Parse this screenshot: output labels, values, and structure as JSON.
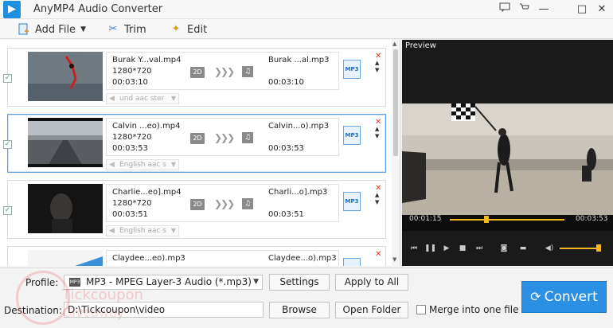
{
  "window": {
    "title": "AnyMP4 Audio Converter",
    "feedback_icon": "chat-icon",
    "cart_icon": "cart-icon",
    "minimize": "—",
    "maximize": "□",
    "close": "✕"
  },
  "toolbar": {
    "add_file_label": "Add File",
    "trim_label": "Trim",
    "edit_label": "Edit"
  },
  "files": [
    {
      "source_name": "Burak Y...val.mp4",
      "resolution": "1280*720",
      "duration": "00:03:10",
      "mode": "2D",
      "output_name": "Burak ...al.mp3",
      "output_duration": "00:03:10",
      "audio_track": "und aac ster",
      "output_format": "MP3"
    },
    {
      "source_name": "Calvin ...eo).mp4",
      "resolution": "1280*720",
      "duration": "00:03:53",
      "mode": "2D",
      "output_name": "Calvin...o).mp3",
      "output_duration": "00:03:53",
      "audio_track": "English aac s",
      "output_format": "MP3"
    },
    {
      "source_name": "Charlie...eo].mp4",
      "resolution": "1280*720",
      "duration": "00:03:51",
      "mode": "2D",
      "output_name": "Charli...o].mp3",
      "output_duration": "00:03:51",
      "audio_track": "English aac s",
      "output_format": "MP3"
    },
    {
      "source_name": "Claydee...eo).mp3",
      "resolution": "",
      "duration": "",
      "mode": "",
      "output_name": "Claydee...o).mp3",
      "output_duration": "",
      "audio_track": "",
      "output_format": "MP3"
    }
  ],
  "preview": {
    "label": "Preview",
    "current_time": "00:01:15",
    "total_time": "00:03:53",
    "seek_fraction": 0.32,
    "volume_fraction": 0.95
  },
  "bottom": {
    "profile_label": "Profile:",
    "profile_value": "MP3 - MPEG Layer-3 Audio (*.mp3)",
    "settings_label": "Settings",
    "apply_all_label": "Apply to All",
    "destination_label": "Destination:",
    "destination_value": "D:\\Tickcoupon\\video",
    "browse_label": "Browse",
    "open_folder_label": "Open Folder",
    "merge_label": "Merge into one file",
    "convert_label": "Convert"
  },
  "watermark": {
    "line1": "Tickcoupon",
    "line2": "Giveaway"
  },
  "colors": {
    "accent": "#2b8fe3",
    "seek": "#f2b81c",
    "delete": "#e03b2a"
  }
}
